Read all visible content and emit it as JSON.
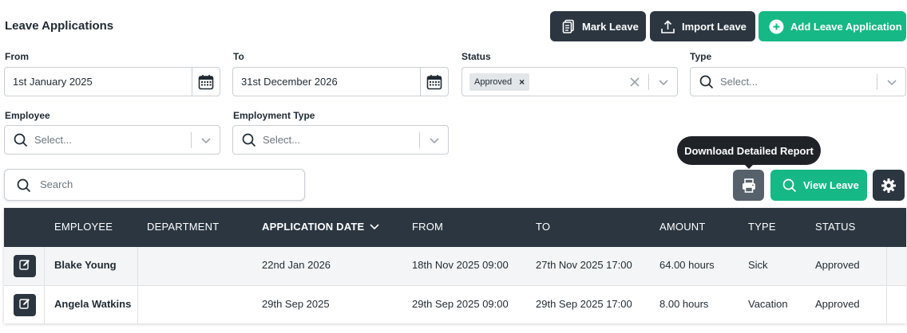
{
  "page": {
    "title": "Leave Applications"
  },
  "toolbar": {
    "mark_leave": "Mark Leave",
    "import_leave": "Import Leave",
    "add_leave_application": "Add Leave Application"
  },
  "filters": {
    "from": {
      "label": "From",
      "value": "1st January 2025"
    },
    "to": {
      "label": "To",
      "value": "31st December 2026"
    },
    "status": {
      "label": "Status",
      "selected": "Approved"
    },
    "type": {
      "label": "Type",
      "placeholder": "Select..."
    },
    "employee": {
      "label": "Employee",
      "placeholder": "Select..."
    },
    "employment_type": {
      "label": "Employment Type",
      "placeholder": "Select..."
    }
  },
  "search": {
    "placeholder": "Search"
  },
  "tooltip": {
    "text": "Download Detailed Report"
  },
  "actions": {
    "view_leave": "View Leave"
  },
  "table": {
    "headers": {
      "employee": "EMPLOYEE",
      "department": "DEPARTMENT",
      "application_date": "APPLICATION DATE",
      "from": "FROM",
      "to": "TO",
      "amount": "AMOUNT",
      "type": "TYPE",
      "status": "STATUS"
    },
    "rows": [
      {
        "employee": "Blake Young",
        "department": "",
        "application_date": "22nd Jan 2026",
        "from": "18th Nov 2025 09:00",
        "to": "27th Nov 2025 17:00",
        "amount": "64.00 hours",
        "type": "Sick",
        "status": "Approved"
      },
      {
        "employee": "Angela Watkins",
        "department": "",
        "application_date": "29th Sep 2025",
        "from": "29th Sep 2025 09:00",
        "to": "29th Sep 2025 17:00",
        "amount": "8.00 hours",
        "type": "Vacation",
        "status": "Approved"
      }
    ]
  },
  "colors": {
    "dark": "#2b3640",
    "green": "#16b885",
    "border": "#c9ced3"
  },
  "icons": [
    "documents-icon",
    "upload-icon",
    "plus-circle-icon",
    "calendar-icon",
    "search-icon",
    "chevron-down-icon",
    "clear-icon",
    "printer-icon",
    "gear-icon",
    "edit-icon",
    "sort-down-icon"
  ]
}
